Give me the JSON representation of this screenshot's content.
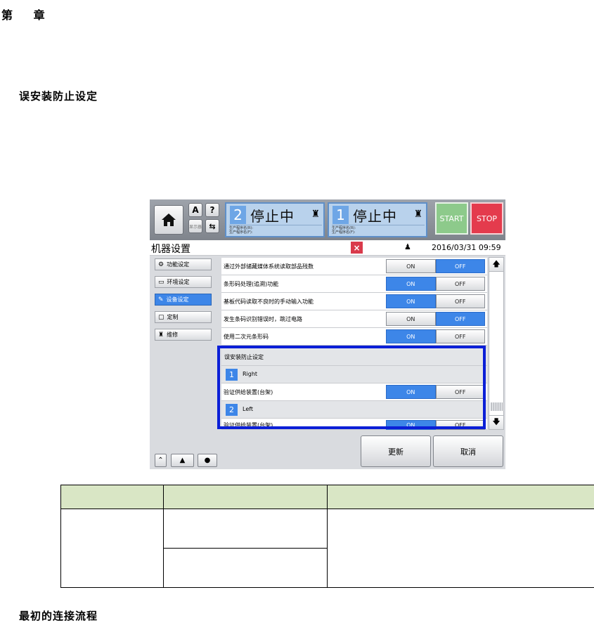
{
  "document": {
    "chapter": "第 章",
    "section_heading": "误安装防止设定",
    "next_heading": "最初的连接流程"
  },
  "ui": {
    "topbar": {
      "small_buttons": {
        "a": "A",
        "q": "?",
        "sw": "显示器"
      },
      "lanes": [
        {
          "number": "2",
          "status": "停止中",
          "info1": "生产程序名(R):",
          "info2": "生产程序名(F):"
        },
        {
          "number": "1",
          "status": "停止中",
          "info1": "生产程序名(R):",
          "info2": "生产程序名(F):"
        }
      ],
      "start": "START",
      "stop": "STOP"
    },
    "titlebar": {
      "title": "机器设置",
      "close": "×",
      "datetime": "2016/03/31 09:59"
    },
    "sidebar": [
      {
        "label": "功能设定",
        "active": false
      },
      {
        "label": "环境设定",
        "active": false
      },
      {
        "label": "设备设定",
        "active": true
      },
      {
        "label": "定制",
        "active": false
      },
      {
        "label": "维修",
        "active": false
      }
    ],
    "settings": [
      {
        "label": "通过外部储藏媒体系统读取部品残数",
        "on": "ON",
        "off": "OFF",
        "value": "OFF"
      },
      {
        "label": "条形码处理(追溯)功能",
        "on": "ON",
        "off": "OFF",
        "value": "ON"
      },
      {
        "label": "基板代码读取不良时的手动输入功能",
        "on": "ON",
        "off": "OFF",
        "value": "ON"
      },
      {
        "label": "发生条码识别错误时，跳过电路",
        "on": "ON",
        "off": "OFF",
        "value": "OFF"
      },
      {
        "label": "使用二次元条形码",
        "on": "ON",
        "off": "OFF",
        "value": "ON"
      }
    ],
    "group": {
      "title": "误安装防止设定",
      "lanes": [
        {
          "num": "1",
          "name": "Right",
          "item": "验证供给装置(台架)",
          "on": "ON",
          "off": "OFF",
          "value": "ON"
        },
        {
          "num": "2",
          "name": "Left",
          "item": "验证供给装置(台架)",
          "on": "ON",
          "off": "OFF",
          "value": "ON"
        }
      ]
    },
    "actions": {
      "update": "更新",
      "cancel": "取消"
    }
  },
  "colors": {
    "accent_blue": "#3d86e8",
    "highlight_frame": "#0b1fd7",
    "start_green": "#8dca8b",
    "stop_red": "#e43b4d",
    "table_header": "#d9e6c5"
  }
}
